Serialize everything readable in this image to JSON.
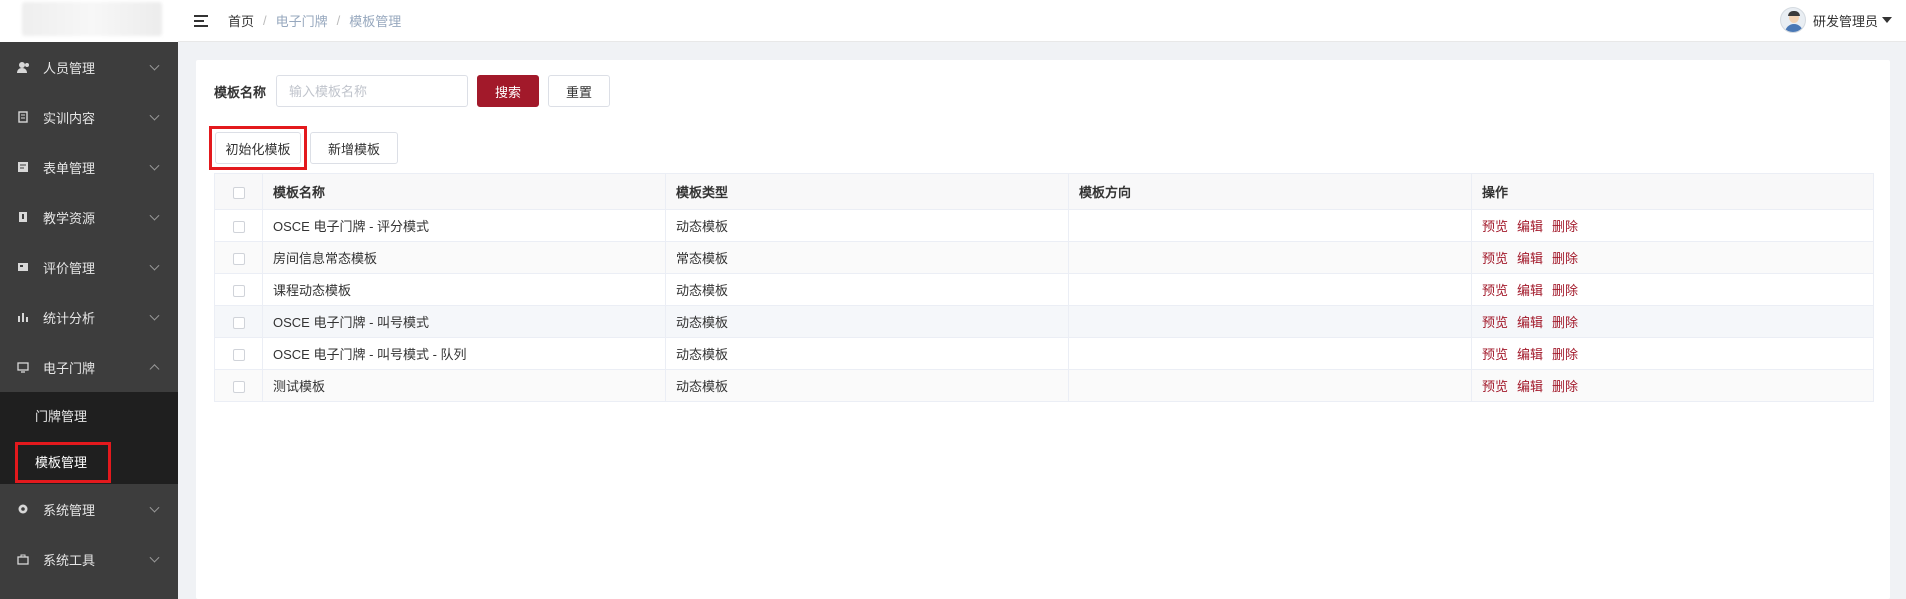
{
  "sidebar": {
    "logo_alt": "",
    "items": [
      {
        "label": "人员管理",
        "icon": "user-icon",
        "expanded": false
      },
      {
        "label": "实训内容",
        "icon": "document-icon",
        "expanded": false
      },
      {
        "label": "表单管理",
        "icon": "form-icon",
        "expanded": false
      },
      {
        "label": "教学资源",
        "icon": "book-icon",
        "expanded": false
      },
      {
        "label": "评价管理",
        "icon": "evaluation-icon",
        "expanded": false
      },
      {
        "label": "统计分析",
        "icon": "bar-chart-icon",
        "expanded": false
      },
      {
        "label": "电子门牌",
        "icon": "monitor-icon",
        "expanded": true
      },
      {
        "label": "系统管理",
        "icon": "gear-icon",
        "expanded": false
      },
      {
        "label": "系统工具",
        "icon": "toolbox-icon",
        "expanded": false
      }
    ],
    "subitems": [
      {
        "label": "门牌管理",
        "active": false
      },
      {
        "label": "模板管理",
        "active": true
      }
    ]
  },
  "header": {
    "breadcrumb": [
      "首页",
      "电子门牌",
      "模板管理"
    ],
    "breadcrumb_sep": "/",
    "user_name": "研发管理员"
  },
  "search": {
    "label": "模板名称",
    "placeholder": "输入模板名称",
    "value": "",
    "search_button": "搜索",
    "reset_button": "重置"
  },
  "actions": {
    "init_button": "初始化模板",
    "add_button": "新增模板"
  },
  "table": {
    "columns": [
      "模板名称",
      "模板类型",
      "模板方向",
      "操作"
    ],
    "rows": [
      {
        "name": "OSCE 电子门牌 - 评分模式",
        "type": "动态模板",
        "direction": ""
      },
      {
        "name": "房间信息常态模板",
        "type": "常态模板",
        "direction": ""
      },
      {
        "name": "课程动态模板",
        "type": "动态模板",
        "direction": ""
      },
      {
        "name": "OSCE 电子门牌 - 叫号模式",
        "type": "动态模板",
        "direction": ""
      },
      {
        "name": "OSCE 电子门牌 - 叫号模式 - 队列",
        "type": "动态模板",
        "direction": ""
      },
      {
        "name": "测试模板",
        "type": "动态模板",
        "direction": ""
      }
    ],
    "row_actions": [
      "预览",
      "编辑",
      "删除"
    ]
  },
  "colors": {
    "primary": "#a2192a",
    "sidebar_bg": "#3d3d3d",
    "submenu_bg": "#1f1f1f",
    "highlight_box": "#e3191d"
  }
}
